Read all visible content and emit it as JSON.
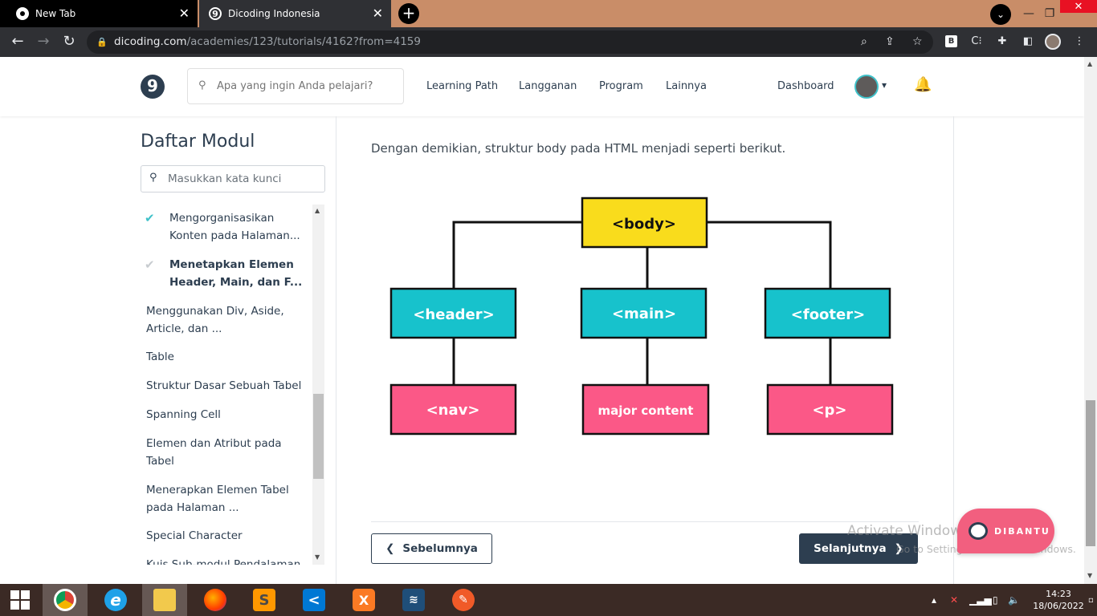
{
  "browser": {
    "tabs": [
      {
        "title": "New Tab",
        "close": "✕"
      },
      {
        "title": "Dicoding Indonesia",
        "close": "✕"
      }
    ],
    "new_tab": "+",
    "url_host": "dicoding.com",
    "url_path": "/academies/123/tutorials/4162?from=4159",
    "ext_b_label": "B",
    "window_controls": {
      "minimize": "—",
      "restore": "❐",
      "close": "✕"
    }
  },
  "site": {
    "logo": "9",
    "search_placeholder": "Apa yang ingin Anda pelajari?",
    "menu": [
      "Learning Path",
      "Langganan",
      "Program",
      "Lainnya"
    ],
    "dashboard": "Dashboard"
  },
  "sidebar": {
    "title": "Daftar Modul",
    "search_placeholder": "Masukkan kata kunci",
    "items": [
      {
        "lines": [
          "Mengorganisasikan",
          "Konten pada Halaman..."
        ],
        "status": "done"
      },
      {
        "lines": [
          "Menetapkan Elemen",
          "Header, Main, dan F..."
        ],
        "status": "current"
      },
      {
        "lines": [
          "Menggunakan Div, Aside,",
          "Article, dan ..."
        ],
        "status": "none"
      },
      {
        "lines": [
          "Table"
        ],
        "status": "none"
      },
      {
        "lines": [
          "Struktur Dasar Sebuah Tabel"
        ],
        "status": "none"
      },
      {
        "lines": [
          "Spanning Cell"
        ],
        "status": "none"
      },
      {
        "lines": [
          "Elemen dan Atribut pada",
          "Tabel"
        ],
        "status": "none"
      },
      {
        "lines": [
          "Menerapkan Elemen Tabel",
          "pada Halaman ..."
        ],
        "status": "none"
      },
      {
        "lines": [
          "Special Character"
        ],
        "status": "none"
      },
      {
        "lines": [
          "Kuis Sub-modul Pendalaman"
        ],
        "status": "none"
      }
    ]
  },
  "content": {
    "paragraph": "Dengan demikian, struktur body pada HTML menjadi seperti berikut.",
    "diagram": {
      "root": "<body>",
      "children": [
        "<header>",
        "<main>",
        "<footer>"
      ],
      "grandchildren": [
        "<nav>",
        "major content",
        "<p>"
      ],
      "colors": {
        "root": "#f9dc1c",
        "child": "#17c2cc",
        "grandchild": "#fb5887",
        "line": "#111111"
      }
    },
    "prev_button": "Sebelumnya",
    "next_button": "Selanjutnya"
  },
  "overlay": {
    "watermark_title": "Activate Windows",
    "watermark_sub": "Go to Settings to activate Windows.",
    "chat_button": "DIBANTU"
  },
  "taskbar": {
    "apps": [
      "start",
      "chrome",
      "internet-explorer",
      "file-explorer",
      "firefox",
      "sublime-text",
      "vscode",
      "xampp",
      "mysql-workbench",
      "pen-app"
    ],
    "time": "14:23",
    "date": "18/06/2022"
  },
  "colors": {
    "brand_dark": "#2d3e50",
    "teal_check": "#3fc1c9",
    "pink": "#f25f7f"
  }
}
